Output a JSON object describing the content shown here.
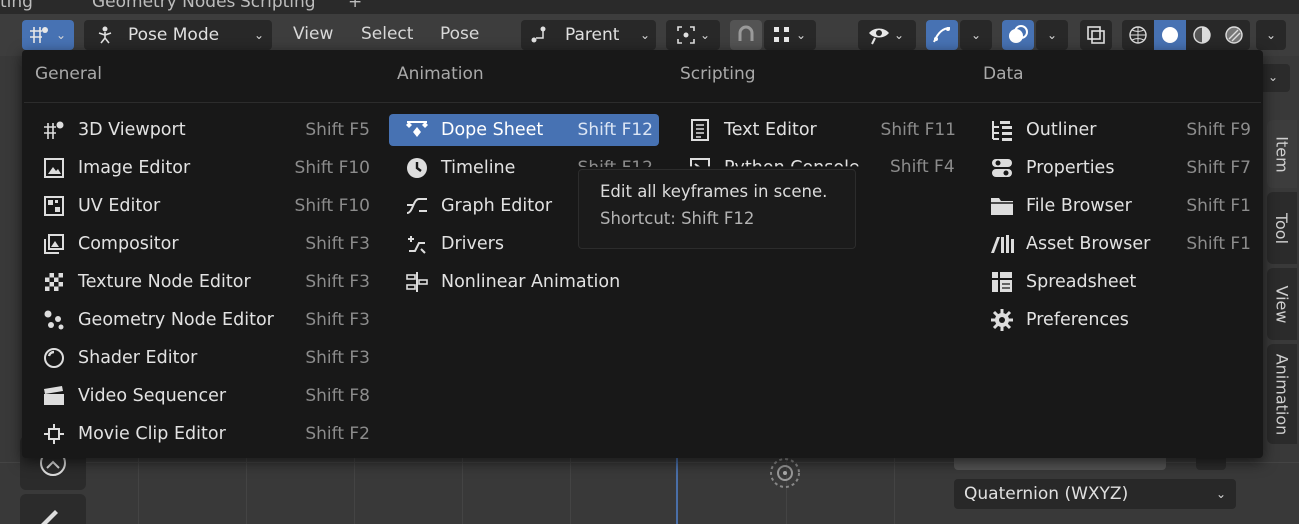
{
  "top_strip": [
    "ting",
    "Geometry Nodes",
    "Scripting",
    "+"
  ],
  "header": {
    "mode": "Pose Mode",
    "menus": [
      "View",
      "Select",
      "Pose"
    ],
    "pivot": "Parent"
  },
  "dropdown": {
    "columns": [
      {
        "title": "General",
        "items": [
          {
            "label": "3D Viewport",
            "shortcut": "Shift F5",
            "icon": "3d-viewport-icon"
          },
          {
            "label": "Image Editor",
            "shortcut": "Shift F10",
            "icon": "image-editor-icon"
          },
          {
            "label": "UV Editor",
            "shortcut": "Shift F10",
            "icon": "uv-editor-icon"
          },
          {
            "label": "Compositor",
            "shortcut": "Shift F3",
            "icon": "compositor-icon"
          },
          {
            "label": "Texture Node Editor",
            "shortcut": "Shift F3",
            "icon": "texture-node-icon"
          },
          {
            "label": "Geometry Node Editor",
            "shortcut": "Shift F3",
            "icon": "geometry-node-icon"
          },
          {
            "label": "Shader Editor",
            "shortcut": "Shift F3",
            "icon": "shader-editor-icon"
          },
          {
            "label": "Video Sequencer",
            "shortcut": "Shift F8",
            "icon": "video-sequencer-icon"
          },
          {
            "label": "Movie Clip Editor",
            "shortcut": "Shift F2",
            "icon": "movie-clip-icon"
          }
        ]
      },
      {
        "title": "Animation",
        "items": [
          {
            "label": "Dope Sheet",
            "shortcut": "Shift F12",
            "icon": "dope-sheet-icon"
          },
          {
            "label": "Timeline",
            "shortcut": "Shift F12",
            "icon": "timeline-icon"
          },
          {
            "label": "Graph Editor",
            "shortcut": "",
            "icon": "graph-editor-icon"
          },
          {
            "label": "Drivers",
            "shortcut": "",
            "icon": "drivers-icon"
          },
          {
            "label": "Nonlinear Animation",
            "shortcut": "",
            "icon": "nla-icon"
          }
        ]
      },
      {
        "title": "Scripting",
        "items": [
          {
            "label": "Text Editor",
            "shortcut": "Shift F11",
            "icon": "text-editor-icon"
          },
          {
            "label": "Python Console",
            "shortcut": "Shift F4",
            "icon": "python-console-icon"
          }
        ]
      },
      {
        "title": "Data",
        "items": [
          {
            "label": "Outliner",
            "shortcut": "Shift F9",
            "icon": "outliner-icon"
          },
          {
            "label": "Properties",
            "shortcut": "Shift F7",
            "icon": "properties-icon"
          },
          {
            "label": "File Browser",
            "shortcut": "Shift F1",
            "icon": "file-browser-icon"
          },
          {
            "label": "Asset Browser",
            "shortcut": "Shift F1",
            "icon": "asset-browser-icon"
          },
          {
            "label": "Spreadsheet",
            "shortcut": "",
            "icon": "spreadsheet-icon"
          },
          {
            "label": "Preferences",
            "shortcut": "",
            "icon": "preferences-icon"
          }
        ]
      }
    ],
    "highlighted": "Dope Sheet"
  },
  "tooltip": {
    "description": "Edit all keyframes in scene.",
    "shortcut": "Shortcut: Shift F12"
  },
  "sidebar_tabs": [
    "Item",
    "Tool",
    "View",
    "Animation"
  ],
  "rotation_mode": "Quaternion (WXYZ)",
  "colors": {
    "accent": "#4772b3",
    "menu_bg": "#181818",
    "header_bg": "#3d3d3d",
    "viewport_bg": "#393939"
  }
}
